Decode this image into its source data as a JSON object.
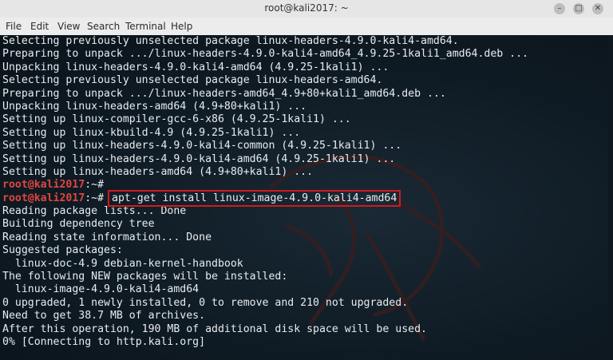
{
  "window": {
    "title": "root@kali2017: ~",
    "controls": {
      "minimize": "–",
      "maximize": "□",
      "close": "✕"
    }
  },
  "menu": {
    "items": [
      "File",
      "Edit",
      "View",
      "Search",
      "Terminal",
      "Help"
    ]
  },
  "terminal": {
    "prompt_user": "root@kali2017",
    "prompt_suffix": ":~#",
    "lines_before": [
      "Selecting previously unselected package linux-headers-4.9.0-kali4-amd64.",
      "Preparing to unpack .../linux-headers-4.9.0-kali4-amd64_4.9.25-1kali1_amd64.deb ...",
      "Unpacking linux-headers-4.9.0-kali4-amd64 (4.9.25-1kali1) ...",
      "Selecting previously unselected package linux-headers-amd64.",
      "Preparing to unpack .../linux-headers-amd64_4.9+80+kali1_amd64.deb ...",
      "Unpacking linux-headers-amd64 (4.9+80+kali1) ...",
      "Setting up linux-compiler-gcc-6-x86 (4.9.25-1kali1) ...",
      "Setting up linux-kbuild-4.9 (4.9.25-1kali1) ...",
      "Setting up linux-headers-4.9.0-kali4-common (4.9.25-1kali1) ...",
      "Setting up linux-headers-4.9.0-kali4-amd64 (4.9.25-1kali1) ...",
      "Setting up linux-headers-amd64 (4.9+80+kali1) ..."
    ],
    "command": "apt-get install linux-image-4.9.0-kali4-amd64",
    "lines_after": [
      "Reading package lists... Done",
      "Building dependency tree",
      "Reading state information... Done",
      "Suggested packages:",
      "  linux-doc-4.9 debian-kernel-handbook",
      "The following NEW packages will be installed:",
      "  linux-image-4.9.0-kali4-amd64",
      "0 upgraded, 1 newly installed, 0 to remove and 210 not upgraded.",
      "Need to get 38.7 MB of archives.",
      "After this operation, 190 MB of additional disk space will be used.",
      "0% [Connecting to http.kali.org]"
    ]
  }
}
